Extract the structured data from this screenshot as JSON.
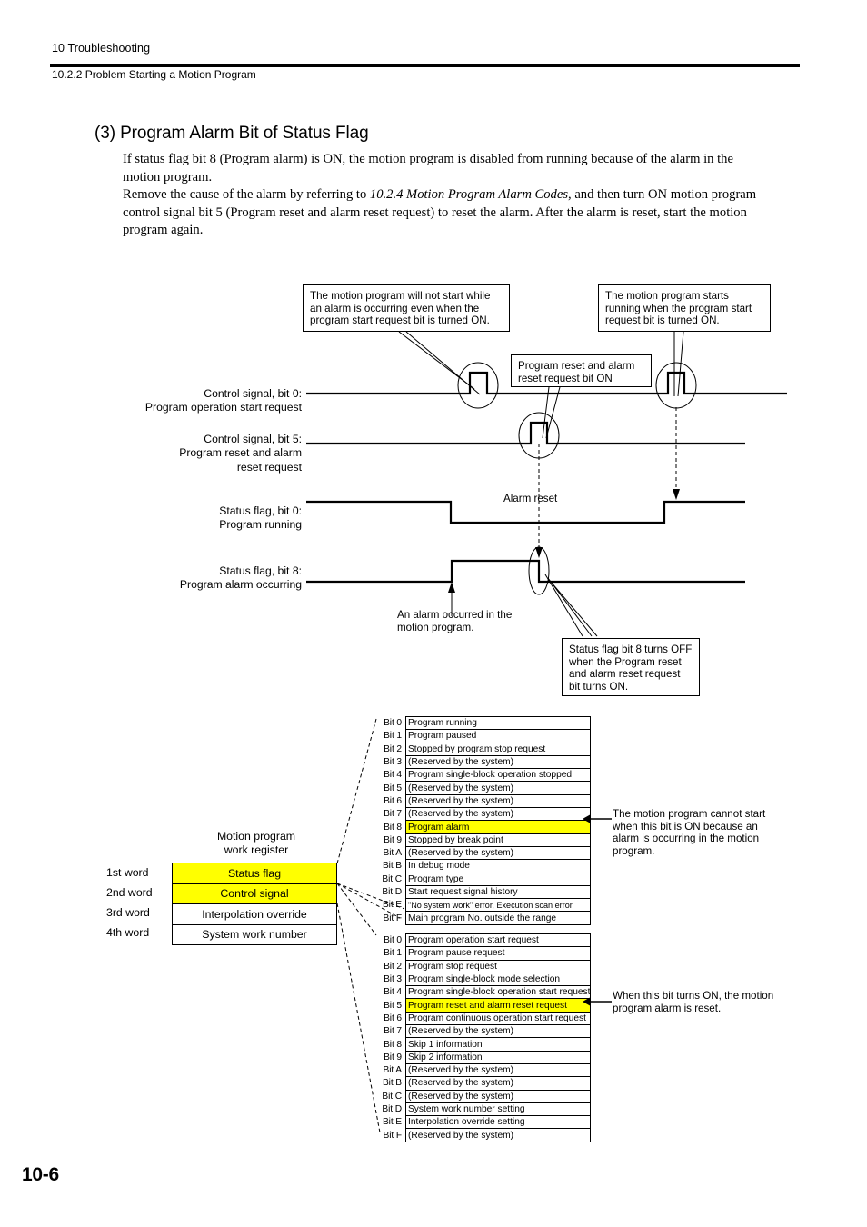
{
  "header": {
    "chapter": "10  Troubleshooting",
    "section": "10.2.2  Problem Starting a Motion Program"
  },
  "content": {
    "heading": "(3) Program Alarm Bit of Status Flag",
    "paragraph_1": "If status flag bit 8 (Program alarm) is ON, the motion program is disabled from running because of the alarm in the motion program.",
    "paragraph_2_a": "Remove the cause of the alarm by referring to ",
    "paragraph_2_italic": "10.2.4 Motion Program Alarm Codes",
    "paragraph_2_b": ", and then turn ON motion program control signal bit 5 (Program reset and alarm reset request) to reset the alarm. After the alarm is reset, start the motion program again."
  },
  "timing_diagram": {
    "callouts": {
      "no_start": "The motion program will not start while an alarm is occurring even when the program start request bit is turned ON.",
      "starts_running": "The motion program starts running when the program start request bit is turned ON.",
      "reset_bit_on": "Program reset and alarm reset request bit ON",
      "bit8_off": "Status flag bit 8 turns OFF when the Program reset and alarm reset request bit turns ON."
    },
    "inline_labels": {
      "alarm_reset": "Alarm reset",
      "alarm_occurred": "An alarm occurred in the motion program."
    },
    "signals": [
      {
        "line1": "Control signal, bit 0:",
        "line2": "Program operation start request",
        "indent": false
      },
      {
        "line1": "Control signal, bit 5:",
        "line2": "Program reset and alarm",
        "line3": "reset request",
        "indent": true
      },
      {
        "line1": "Status flag, bit 0:",
        "line2": "Program running",
        "indent": true
      },
      {
        "line1": "Status flag, bit 8:",
        "line2": "Program alarm occurring",
        "indent": true
      }
    ]
  },
  "register": {
    "title_line1": "Motion program",
    "title_line2": "work register",
    "rows": [
      {
        "word": "1st word",
        "name": "Status flag",
        "highlight": true
      },
      {
        "word": "2nd word",
        "name": "Control signal",
        "highlight": true
      },
      {
        "word": "3rd word",
        "name": "Interpolation override",
        "highlight": false
      },
      {
        "word": "4th word",
        "name": "System work number",
        "highlight": false
      }
    ]
  },
  "status_flag_table": {
    "rows": [
      {
        "bit": "Bit 0",
        "desc": "Program running",
        "highlight": false
      },
      {
        "bit": "Bit 1",
        "desc": "Program paused",
        "highlight": false
      },
      {
        "bit": "Bit 2",
        "desc": "Stopped by program stop request",
        "highlight": false
      },
      {
        "bit": "Bit 3",
        "desc": "(Reserved by the system)",
        "highlight": false
      },
      {
        "bit": "Bit 4",
        "desc": "Program single-block operation stopped",
        "highlight": false
      },
      {
        "bit": "Bit 5",
        "desc": "(Reserved by the  system)",
        "highlight": false
      },
      {
        "bit": "Bit 6",
        "desc": "(Reserved by the system)",
        "highlight": false
      },
      {
        "bit": "Bit 7",
        "desc": "(Reserved by the system)",
        "highlight": false
      },
      {
        "bit": "Bit 8",
        "desc": "Program alarm",
        "highlight": true
      },
      {
        "bit": "Bit 9",
        "desc": "Stopped by break point",
        "highlight": false
      },
      {
        "bit": "Bit A",
        "desc": "(Reserved by the system)",
        "highlight": false
      },
      {
        "bit": "Bit B",
        "desc": "In debug mode",
        "highlight": false
      },
      {
        "bit": "Bit C",
        "desc": "Program type",
        "highlight": false
      },
      {
        "bit": "Bit D",
        "desc": "Start request signal history",
        "highlight": false
      },
      {
        "bit": "Bit E",
        "desc": "\"No system work\" error, Execution scan error",
        "highlight": false,
        "small": true
      },
      {
        "bit": "Bit F",
        "desc": "Main program No. outside the range",
        "highlight": false
      }
    ],
    "annotation": "The motion program cannot start when this bit is ON because an alarm is occurring in the motion program."
  },
  "control_signal_table": {
    "rows": [
      {
        "bit": "Bit 0",
        "desc": "Program operation start request",
        "highlight": false
      },
      {
        "bit": "Bit 1",
        "desc": "Program pause request",
        "highlight": false
      },
      {
        "bit": "Bit 2",
        "desc": "Program stop request",
        "highlight": false
      },
      {
        "bit": "Bit 3",
        "desc": "Program single-block mode selection",
        "highlight": false
      },
      {
        "bit": "Bit 4",
        "desc": "Program single-block operation start request",
        "highlight": false
      },
      {
        "bit": "Bit 5",
        "desc": "Program reset and alarm reset request",
        "highlight": true
      },
      {
        "bit": "Bit 6",
        "desc": "Program continuous operation start request",
        "highlight": false
      },
      {
        "bit": "Bit 7",
        "desc": "(Reserved by the system)",
        "highlight": false
      },
      {
        "bit": "Bit 8",
        "desc": "Skip 1 information",
        "highlight": false
      },
      {
        "bit": "Bit 9",
        "desc": "Skip 2 information",
        "highlight": false
      },
      {
        "bit": "Bit A",
        "desc": "(Reserved by the system)",
        "highlight": false
      },
      {
        "bit": "Bit B",
        "desc": "(Reserved by the system)",
        "highlight": false
      },
      {
        "bit": "Bit C",
        "desc": "(Reserved by the system)",
        "highlight": false
      },
      {
        "bit": "Bit D",
        "desc": "System work number setting",
        "highlight": false
      },
      {
        "bit": "Bit E",
        "desc": "Interpolation override setting",
        "highlight": false
      },
      {
        "bit": "Bit F",
        "desc": "(Reserved by the system)",
        "highlight": false
      }
    ],
    "annotation": "When this bit turns ON, the motion program alarm is reset."
  },
  "footer": {
    "page_number": "10-6"
  },
  "colors": {
    "highlight": "#ffff00",
    "line": "#000000",
    "background": "#ffffff"
  }
}
